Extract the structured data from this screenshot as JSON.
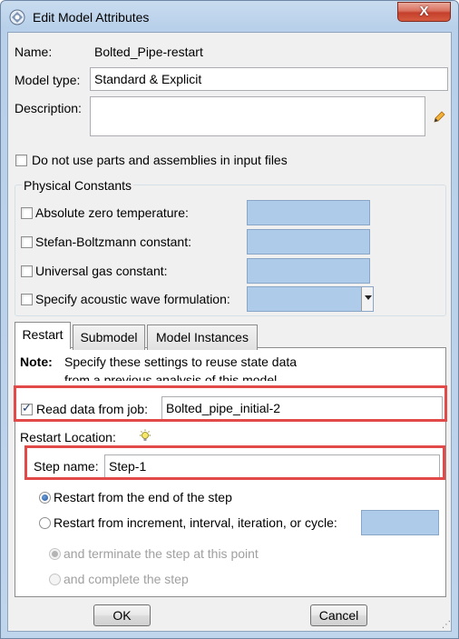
{
  "window": {
    "title": "Edit Model Attributes",
    "close_glyph": "X"
  },
  "name": {
    "label": "Name:",
    "value": "Bolted_Pipe-restart"
  },
  "model_type": {
    "label": "Model type:",
    "value": "Standard & Explicit"
  },
  "description": {
    "label": "Description:",
    "value": "",
    "edit_icon": "pencil-icon"
  },
  "no_parts": {
    "label": "Do not use parts and assemblies in input files",
    "checked": false
  },
  "physical_constants": {
    "title": "Physical Constants",
    "items": [
      {
        "label": "Absolute zero temperature:",
        "checked": false,
        "value": ""
      },
      {
        "label": "Stefan-Boltzmann constant:",
        "checked": false,
        "value": ""
      },
      {
        "label": "Universal gas constant:",
        "checked": false,
        "value": ""
      },
      {
        "label": "Specify acoustic wave formulation:",
        "checked": false,
        "value": ""
      }
    ]
  },
  "tabs": [
    {
      "label": "Restart",
      "active": true
    },
    {
      "label": "Submodel",
      "active": false
    },
    {
      "label": "Model Instances",
      "active": false
    }
  ],
  "restart": {
    "note_label": "Note:",
    "note_line1": "Specify these settings to reuse state data",
    "note_line2": "from a previous analysis of this model.",
    "read_data": {
      "label": "Read data from job:",
      "checked": true,
      "value": "Bolted_pipe_initial-2"
    },
    "location_label": "Restart Location:",
    "location_icon": "lightbulb-icon",
    "step_name": {
      "label": "Step name:",
      "value": "Step-1"
    },
    "options": [
      {
        "label": "Restart from the end of the step",
        "selected": true
      },
      {
        "label": "Restart from increment, interval, iteration, or cycle:",
        "selected": false
      }
    ],
    "increment_value": "",
    "sub_options": [
      {
        "label": "and terminate the step at this point",
        "selected": true,
        "enabled": false
      },
      {
        "label": "and complete the step",
        "selected": false,
        "enabled": false
      }
    ]
  },
  "buttons": {
    "ok": "OK",
    "cancel": "Cancel"
  },
  "colors": {
    "highlight": "#e24a4a",
    "field_blue": "#aecbea",
    "title_bar": "#bfd5ec"
  }
}
